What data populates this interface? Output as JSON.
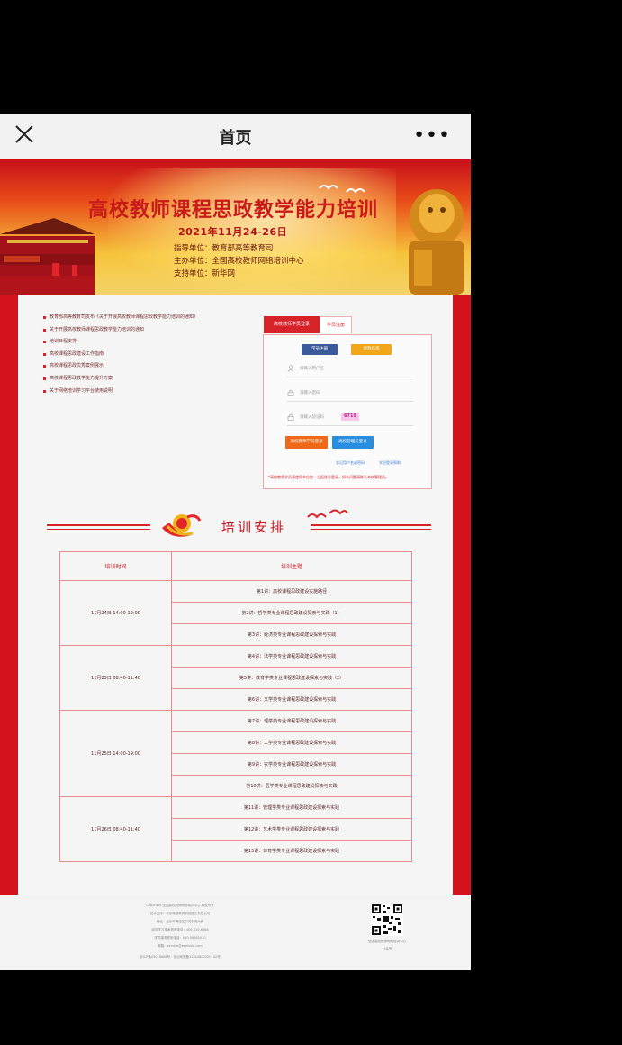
{
  "nav": {
    "title": "首页",
    "more": "•••"
  },
  "banner": {
    "title": "高校教师课程思政教学能力培训",
    "date": "2021年11月24-26日",
    "guide_unit": "指导单位：教育部高等教育司",
    "host_unit": "主办单位：全国高校教师网络培训中心",
    "support_unit": "支持单位：新华网"
  },
  "notices": [
    "教育部高等教育司发布《关于开展高校教师课程思政教学能力培训的通知》",
    "关于开展高校教师课程思政教学能力培训的通知",
    "培训日程安排",
    "高校课程思政建设工作指南",
    "高校课程思政优秀案例展示",
    "高校课程思政教学能力提升方案",
    "关于网络培训学习平台使用说明"
  ],
  "login": {
    "tab_teacher": "高校教师学员登录",
    "tab_student": "学员注册",
    "register_label": "学员注册",
    "change_label": "修改信息",
    "username_placeholder": "请输入用户名",
    "password_placeholder": "请输入密码",
    "captcha_placeholder": "请输入验证码",
    "captcha_code": "6719",
    "login_label": "高校教师学员登录",
    "admin_label": "高校管理员登录",
    "forgot_label": "忘记用户名或密码",
    "help_label": "学员登录帮助",
    "tip": "*高校教师学员请使用单位统一分配账号登录，如有问题请联系本校管理员。"
  },
  "section": {
    "title": "培训安排"
  },
  "schedule": {
    "header_time": "培训时间",
    "header_topic": "培训主题",
    "rows": [
      {
        "time": "11月24日 14:00-19:00",
        "topics": [
          "第1讲：高校课程思政建设实施路径",
          "第2讲：哲学类专业课程思政建设探索与实践（1）",
          "第3讲：经济类专业课程思政建设探索与实践"
        ]
      },
      {
        "time": "11月25日 08:40-11:40",
        "topics": [
          "第4讲：法学类专业课程思政建设探索与实践",
          "第5讲：教育学类专业课程思政建设探索与实践（2）",
          "第6讲：文学类专业课程思政建设探索与实践"
        ]
      },
      {
        "time": "11月25日 14:00-19:00",
        "topics": [
          "第7讲：理学类专业课程思政建设探索与实践",
          "第8讲：工学类专业课程思政建设探索与实践",
          "第9讲：农学类专业课程思政建设探索与实践",
          "第10讲：医学类专业课程思政建设探索与实践"
        ]
      },
      {
        "time": "11月26日 08:40-11:40",
        "topics": [
          "第11讲：管理学类专业课程思政建设探索与实践",
          "第12讲：艺术学类专业课程思政建设探索与实践",
          "第13讲：体育学类专业课程思政建设探索与实践"
        ]
      }
    ]
  },
  "footer": {
    "lines": [
      "Copyright 全国高校教师网络培训中心 版权所有",
      "技术支持：北京畅想教育科技股份有限公司",
      "地址：北京市海淀区中关村南大街",
      "培训学习技术咨询电话：400-810-6568",
      "学员事务联系电话：010-58582010",
      "邮箱：service@enetedu.com",
      "京ICP备05018866号 · 京公网安备11010802020142号"
    ],
    "qr_caption": "全国高校教师网络培训中心",
    "qr_caption2": "公众号"
  }
}
